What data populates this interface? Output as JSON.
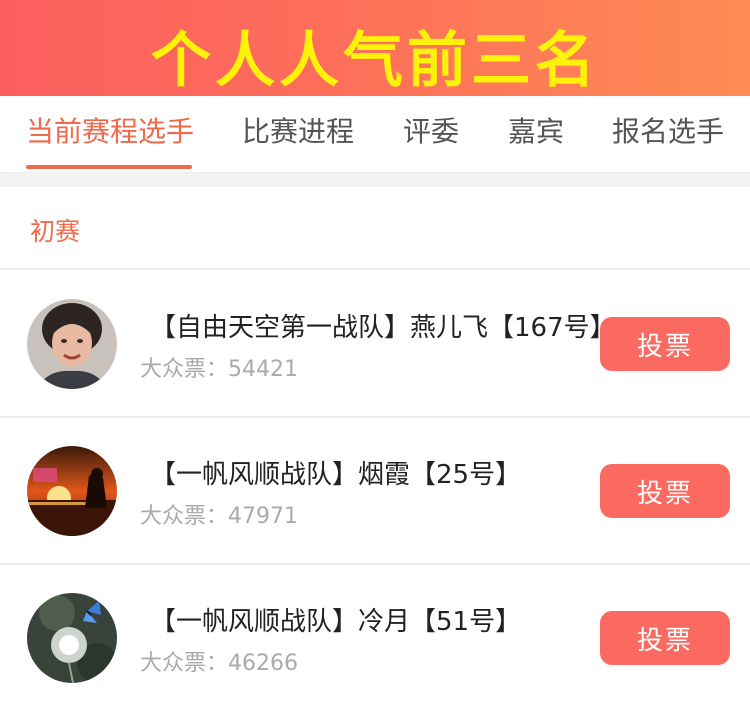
{
  "banner": {
    "title": "个人人气前三名"
  },
  "tabs": [
    {
      "label": "当前赛程选手",
      "active": true
    },
    {
      "label": "比赛进程",
      "active": false
    },
    {
      "label": "评委",
      "active": false
    },
    {
      "label": "嘉宾",
      "active": false
    },
    {
      "label": "报名选手",
      "active": false
    }
  ],
  "section": {
    "round_label": "初赛"
  },
  "contestants": [
    {
      "title": "【自由天空第一战队】燕儿飞【167号】",
      "votes_label": "大众票：",
      "votes": "54421",
      "vote_button": "投票",
      "avatar_icon": "portrait-woman-icon"
    },
    {
      "title": "【一帆风顺战队】烟霞【25号】",
      "votes_label": "大众票：",
      "votes": "47971",
      "vote_button": "投票",
      "avatar_icon": "sunset-silhouette-icon"
    },
    {
      "title": "【一帆风顺战队】冷月【51号】",
      "votes_label": "大众票：",
      "votes": "46266",
      "vote_button": "投票",
      "avatar_icon": "dandelion-butterfly-icon"
    }
  ],
  "colors": {
    "accent": "#ee6a4a",
    "button": "#fa6a61",
    "banner_title": "#fff20a"
  }
}
